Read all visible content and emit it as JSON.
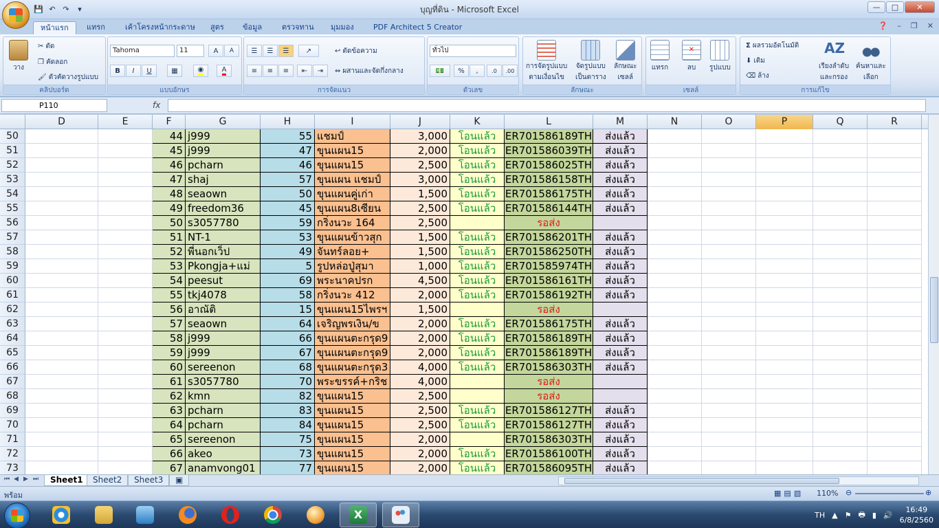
{
  "window": {
    "title": "บุญที่ดิน - Microsoft Excel"
  },
  "tabs": [
    "หน้าแรก",
    "แทรก",
    "เค้าโครงหน้ากระดาษ",
    "สูตร",
    "ข้อมูล",
    "ตรวจทาน",
    "มุมมอง",
    "PDF Architect 5 Creator"
  ],
  "ribbon": {
    "clipboard": {
      "paste": "วาง",
      "cut": "ตัด",
      "copy": "คัดลอก",
      "format_painter": "ตัวคัดวางรูปแบบ",
      "label": "คลิปบอร์ด"
    },
    "font": {
      "name": "Tahoma",
      "size": "11",
      "bold": "B",
      "italic": "I",
      "underline": "U",
      "label": "แบบอักษร"
    },
    "alignment": {
      "wrap": "ตัดข้อความ",
      "merge": "ผสานและจัดกึ่งกลาง",
      "label": "การจัดแนว"
    },
    "number": {
      "format": "ทั่วไป",
      "percent": "%",
      "comma": ",",
      "label": "ตัวเลข"
    },
    "styles": {
      "conditional_line1": "การจัดรูปแบบ",
      "conditional_line2": "ตามเงื่อนไข",
      "table_line1": "จัดรูปแบบ",
      "table_line2": "เป็นตาราง",
      "cell_line1": "ลักษณะ",
      "cell_line2": "เซลล์",
      "label": "ลักษณะ"
    },
    "cells": {
      "insert": "แทรก",
      "delete": "ลบ",
      "format": "รูปแบบ",
      "label": "เซลล์"
    },
    "editing": {
      "autosum": "ผลรวมอัตโนมัติ",
      "fill": "เติม",
      "clear": "ล้าง",
      "sort_line1": "เรียงลำดับ",
      "sort_line2": "และกรอง",
      "find_line1": "ค้นหาและ",
      "find_line2": "เลือก",
      "label": "การแก้ไข"
    }
  },
  "formula_bar": {
    "name_box": "P110",
    "fx": "fx",
    "value": ""
  },
  "columns": [
    "D",
    "E",
    "F",
    "G",
    "H",
    "I",
    "J",
    "K",
    "L",
    "M",
    "N",
    "O",
    "P",
    "Q",
    "R"
  ],
  "selected_column": "P",
  "rows": [
    {
      "n": "50",
      "F": "44",
      "G": "j999",
      "H": "55",
      "I": "แชมป์",
      "J": "3,000",
      "K": "โอนแล้ว",
      "L": "ER701586189TH",
      "M": "ส่งแล้ว"
    },
    {
      "n": "51",
      "F": "45",
      "G": "j999",
      "H": "47",
      "I": "ขุนแผน15",
      "J": "2,000",
      "K": "โอนแล้ว",
      "L": "ER701586039TH",
      "M": "ส่งแล้ว"
    },
    {
      "n": "52",
      "F": "46",
      "G": "pcharn",
      "H": "46",
      "I": "ขุนแผน15",
      "J": "2,500",
      "K": "โอนแล้ว",
      "L": "ER701586025TH",
      "M": "ส่งแล้ว"
    },
    {
      "n": "53",
      "F": "47",
      "G": "shaj",
      "H": "57",
      "I": "ขุนแผน แชมป์",
      "J": "3,000",
      "K": "โอนแล้ว",
      "L": "ER701586158TH",
      "M": "ส่งแล้ว"
    },
    {
      "n": "54",
      "F": "48",
      "G": "seaown",
      "H": "50",
      "I": "ขุนแผนคู่เก่า",
      "J": "1,500",
      "K": "โอนแล้ว",
      "L": "ER701586175TH",
      "M": "ส่งแล้ว"
    },
    {
      "n": "55",
      "F": "49",
      "G": "freedom36",
      "H": "45",
      "I": "ขุนแผน8เซียน",
      "J": "2,500",
      "K": "โอนแล้ว",
      "L": "ER701586144TH",
      "M": "ส่งแล้ว"
    },
    {
      "n": "56",
      "F": "50",
      "G": "s3057780",
      "H": "59",
      "I": "กริ่งนวะ 164",
      "J": "2,500",
      "K": "",
      "L": "รอส่ง",
      "M": ""
    },
    {
      "n": "57",
      "F": "51",
      "G": "NT-1",
      "H": "53",
      "I": "ขุนแผนข้าวสุก",
      "J": "1,500",
      "K": "โอนแล้ว",
      "L": "ER701586201TH",
      "M": "ส่งแล้ว"
    },
    {
      "n": "58",
      "F": "52",
      "G": "พี่นอกเว็ป",
      "H": "49",
      "I": "จันทร์ลอย+",
      "J": "1,500",
      "K": "โอนแล้ว",
      "L": "ER701586250TH",
      "M": "ส่งแล้ว"
    },
    {
      "n": "59",
      "F": "53",
      "G": "Pkongja+แม่",
      "H": "5",
      "I": "รูปหล่อปู่สุมา",
      "J": "1,000",
      "K": "โอนแล้ว",
      "L": "ER701585974TH",
      "M": "ส่งแล้ว"
    },
    {
      "n": "60",
      "F": "54",
      "G": "peesut",
      "H": "69",
      "I": "พระนาคปรก",
      "J": "4,500",
      "K": "โอนแล้ว",
      "L": "ER701586161TH",
      "M": "ส่งแล้ว"
    },
    {
      "n": "61",
      "F": "55",
      "G": "tkj4078",
      "H": "58",
      "I": "กริ่งนวะ 412",
      "J": "2,000",
      "K": "โอนแล้ว",
      "L": "ER701586192TH",
      "M": "ส่งแล้ว"
    },
    {
      "n": "62",
      "F": "56",
      "G": "อาณัติ",
      "H": "15",
      "I": "ขุนแผน15ไพรฯ",
      "J": "1,500",
      "K": "",
      "L": "รอส่ง",
      "M": ""
    },
    {
      "n": "63",
      "F": "57",
      "G": "seaown",
      "H": "64",
      "I": "เจริญพรเงิน/ข",
      "J": "2,000",
      "K": "โอนแล้ว",
      "L": "ER701586175TH",
      "M": "ส่งแล้ว"
    },
    {
      "n": "64",
      "F": "58",
      "G": "j999",
      "H": "66",
      "I": "ขุนแผนตะกรุด9",
      "J": "2,000",
      "K": "โอนแล้ว",
      "L": "ER701586189TH",
      "M": "ส่งแล้ว"
    },
    {
      "n": "65",
      "F": "59",
      "G": "j999",
      "H": "67",
      "I": "ขุนแผนตะกรุด9",
      "J": "2,000",
      "K": "โอนแล้ว",
      "L": "ER701586189TH",
      "M": "ส่งแล้ว"
    },
    {
      "n": "66",
      "F": "60",
      "G": "sereenon",
      "H": "68",
      "I": "ขุนแผนตะกรุด3",
      "J": "4,000",
      "K": "โอนแล้ว",
      "L": "ER701586303TH",
      "M": "ส่งแล้ว"
    },
    {
      "n": "67",
      "F": "61",
      "G": "s3057780",
      "H": "70",
      "I": "พระขรรค์+กริช",
      "J": "4,000",
      "K": "",
      "L": "รอส่ง",
      "M": ""
    },
    {
      "n": "68",
      "F": "62",
      "G": "kmn",
      "H": "82",
      "I": "ขุนแผน15",
      "J": "2,500",
      "K": "",
      "L": "รอส่ง",
      "M": ""
    },
    {
      "n": "69",
      "F": "63",
      "G": "pcharn",
      "H": "83",
      "I": "ขุนแผน15",
      "J": "2,500",
      "K": "โอนแล้ว",
      "L": "ER701586127TH",
      "M": "ส่งแล้ว"
    },
    {
      "n": "70",
      "F": "64",
      "G": "pcharn",
      "H": "84",
      "I": "ขุนแผน15",
      "J": "2,500",
      "K": "โอนแล้ว",
      "L": "ER701586127TH",
      "M": "ส่งแล้ว"
    },
    {
      "n": "71",
      "F": "65",
      "G": "sereenon",
      "H": "75",
      "I": "ขุนแผน15",
      "J": "2,000",
      "K": "",
      "L": "ER701586303TH",
      "M": "ส่งแล้ว"
    },
    {
      "n": "72",
      "F": "66",
      "G": "akeo",
      "H": "73",
      "I": "ขุนแผน15",
      "J": "2,000",
      "K": "โอนแล้ว",
      "L": "ER701586100TH",
      "M": "ส่งแล้ว"
    },
    {
      "n": "73",
      "F": "67",
      "G": "anamvong01",
      "H": "77",
      "I": "ขุนแผน15",
      "J": "2,000",
      "K": "โอนแล้ว",
      "L": "ER701586095TH",
      "M": "ส่งแล้ว"
    }
  ],
  "sheets": [
    "Sheet1",
    "Sheet2",
    "Sheet3"
  ],
  "status": {
    "text": "พร้อม",
    "zoom": "110%"
  },
  "taskbar": {
    "lang": "TH",
    "time": "16:49",
    "date": "6/8/2560"
  },
  "colors": {
    "waiting": "#e01b1b",
    "transferred": "#1a9a3b",
    "selected_header": "#f1b74c"
  }
}
